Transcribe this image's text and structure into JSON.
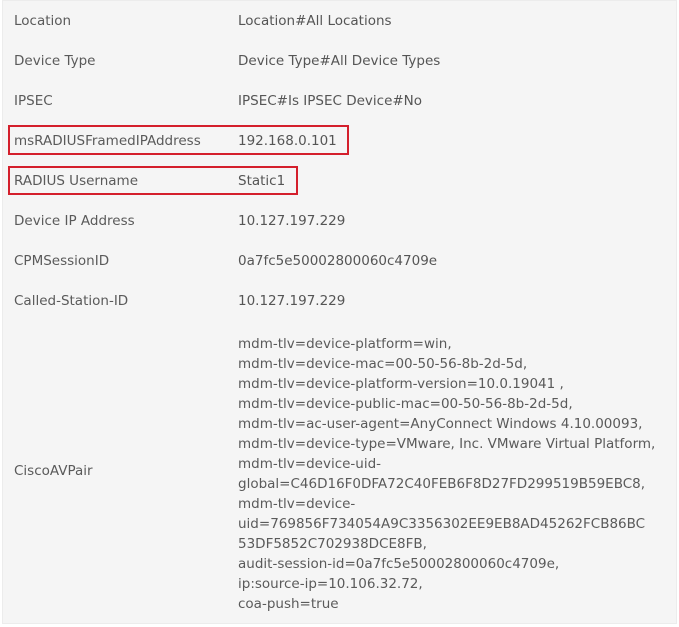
{
  "rows": [
    {
      "label": "Location",
      "value": "Location#All Locations"
    },
    {
      "label": "Device Type",
      "value": "Device Type#All Device Types"
    },
    {
      "label": "IPSEC",
      "value": "IPSEC#Is IPSEC Device#No"
    },
    {
      "label": "msRADIUSFramedIPAddress",
      "value": "192.168.0.101"
    },
    {
      "label": "RADIUS Username",
      "value": "Static1"
    },
    {
      "label": "Device IP Address",
      "value": "10.127.197.229"
    },
    {
      "label": "CPMSessionID",
      "value": "0a7fc5e50002800060c4709e"
    },
    {
      "label": "Called-Station-ID",
      "value": "10.127.197.229"
    }
  ],
  "avpair": {
    "label": "CiscoAVPair",
    "lines": [
      "mdm-tlv=device-platform=win,",
      "mdm-tlv=device-mac=00-50-56-8b-2d-5d,",
      "mdm-tlv=device-platform-version=10.0.19041 ,",
      "mdm-tlv=device-public-mac=00-50-56-8b-2d-5d,",
      "mdm-tlv=ac-user-agent=AnyConnect Windows 4.10.00093,",
      "mdm-tlv=device-type=VMware, Inc. VMware Virtual Platform,",
      "mdm-tlv=device-uid-",
      "global=C46D16F0DFA72C40FEB6F8D27FD299519B59EBC8,",
      "mdm-tlv=device-",
      "uid=769856F734054A9C3356302EE9EB8AD45262FCB86BC",
      "53DF5852C702938DCE8FB,",
      "audit-session-id=0a7fc5e50002800060c4709e,",
      "ip:source-ip=10.106.32.72,",
      "coa-push=true"
    ]
  },
  "highlight_color": "#d41f2c"
}
